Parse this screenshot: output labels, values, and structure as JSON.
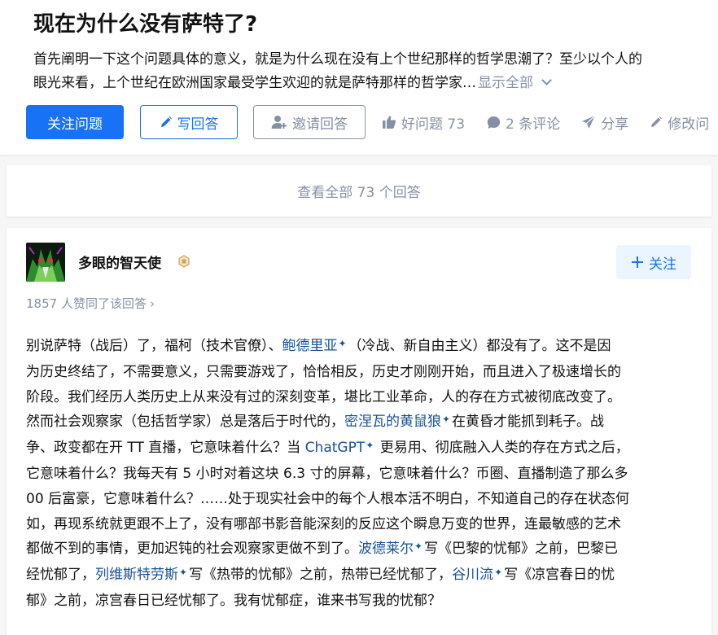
{
  "question": {
    "title": "现在为什么没有萨特了?",
    "detail_line1": "首先阐明一下这个问题具体的意义，就是为什么现在没有上个世纪那样的哲学思潮了？至少以个人的",
    "detail_line2": "眼光来看，上个世纪在欧洲国家最受学生欢迎的就是萨特那样的哲学家…",
    "show_all": "显示全部"
  },
  "actions": {
    "follow": "关注问题",
    "write_answer": "写回答",
    "invite": "邀请回答",
    "good_question": "好问题 73",
    "comments": "2 条评论",
    "share": "分享",
    "edit": "修改问"
  },
  "view_all": "查看全部 73 个回答",
  "answer": {
    "author": "多眼的智天使",
    "follow_label": "关注",
    "upvotes": "1857 人赞同了该回答",
    "upvote_arrow": "›",
    "lines": [
      [
        {
          "t": "别说萨特（战后）了，福柯（技术官僚）、"
        },
        {
          "t": "鲍德里亚",
          "link": true
        },
        {
          "t": "（冷战、新自由主义）都没有了。这不是因"
        }
      ],
      [
        {
          "t": "为历史终结了，不需要意义，只需要游戏了，恰恰相反，历史才刚刚开始，而且进入了极速增长的"
        }
      ],
      [
        {
          "t": "阶段。我们经历人类历史上从来没有过的深刻变革，堪比工业革命，人的存在方式被彻底改变了。"
        }
      ],
      [
        {
          "t": "然而社会观察家（包括哲学家）总是落后于时代的，"
        },
        {
          "t": "密涅瓦的黄鼠狼",
          "link": true
        },
        {
          "t": "在黄昏才能抓到耗子。战"
        }
      ],
      [
        {
          "t": "争、政变都在开 TT 直播，它意味着什么？当 "
        },
        {
          "t": "ChatGPT",
          "link": true
        },
        {
          "t": " 更易用、彻底融入人类的存在方式之后，"
        }
      ],
      [
        {
          "t": "它意味着什么？我每天有 5 小时对着这块 6.3 寸的屏幕，它意味着什么？币圈、直播制造了那么多"
        }
      ],
      [
        {
          "t": "00 后富豪，它意味着什么？……处于现实社会中的每个人根本活不明白，不知道自己的存在状态何"
        }
      ],
      [
        {
          "t": "如，再现系统就更跟不上了，没有哪部书影音能深刻的反应这个瞬息万变的世界，连最敏感的艺术"
        }
      ],
      [
        {
          "t": "都做不到的事情，更加迟钝的社会观察家更做不到了。"
        },
        {
          "t": "波德莱尔",
          "link": true
        },
        {
          "t": "写《巴黎的忧郁》之前，巴黎已"
        }
      ],
      [
        {
          "t": "经忧郁了，"
        },
        {
          "t": "列维斯特劳斯",
          "link": true
        },
        {
          "t": "写《热带的忧郁》之前，热带已经忧郁了，"
        },
        {
          "t": "谷川流",
          "link": true
        },
        {
          "t": "写《凉宫春日的忧"
        }
      ],
      [
        {
          "t": "郁》之前，凉宫春日已经忧郁了。我有忧郁症，谁来书写我的忧郁？"
        }
      ]
    ]
  },
  "colors": {
    "primary": "#1772f6",
    "link": "#175199",
    "muted": "#8590a6",
    "text": "#121212",
    "page_bg": "#f6f6f6"
  }
}
